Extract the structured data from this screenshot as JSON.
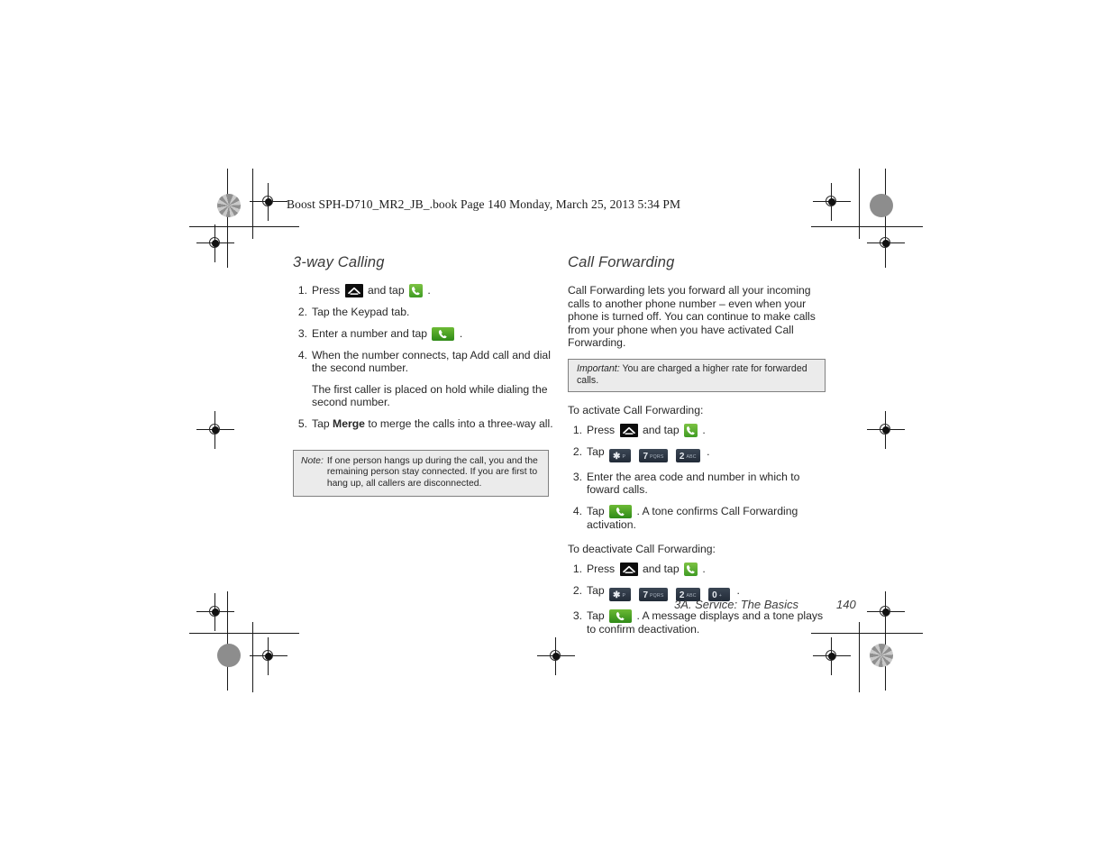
{
  "running_header": "Boost SPH-D710_MR2_JB_.book  Page 140  Monday, March 25, 2013  5:34 PM",
  "left_column": {
    "title": "3-way Calling",
    "steps": [
      {
        "num": "1.",
        "before": "Press",
        "icon1": "home-icon",
        "mid": "and tap",
        "icon2": "phone-green-icon",
        "after": "."
      },
      {
        "num": "2.",
        "text": "Tap the Keypad tab."
      },
      {
        "num": "3.",
        "before": "Enter a number and tap",
        "icon1": "phone-green-wide-icon",
        "after": "."
      },
      {
        "num": "4.",
        "text": "When the number connects, tap Add call and dial the second number."
      },
      {
        "num": "5.",
        "before": "Tap",
        "bold": "Merge",
        "after": "to merge the calls into a three-way all."
      }
    ],
    "sub_paragraph": "The first caller is placed on hold while dialing the second number.",
    "note": {
      "label": "Note:",
      "body": "If one person hangs up during the call, you and the remaining person stay connected. If you are first to hang up, all callers are disconnected."
    }
  },
  "right_column": {
    "title": "Call Forwarding",
    "intro": "Call Forwarding lets you forward all your incoming calls to another phone number – even when your phone is turned off. You can continue to make calls from your phone when you have activated Call Forwarding.",
    "important": {
      "label": "Important:",
      "body": "You are charged a higher rate for forwarded calls."
    },
    "activate_lead_in": "To activate Call Forwarding:",
    "activate_steps": [
      {
        "num": "1.",
        "before": "Press",
        "icon1": "home-icon",
        "mid": "and tap",
        "icon2": "phone-green-icon",
        "after": "."
      },
      {
        "num": "2.",
        "before": "Tap",
        "keys": [
          "star",
          "seven",
          "two"
        ],
        "after": "."
      },
      {
        "num": "3.",
        "text": "Enter the area code and number in which to foward calls."
      },
      {
        "num": "4.",
        "before": "Tap",
        "icon1": "phone-green-wide-icon",
        "after": ". A tone confirms Call Forwarding activation."
      }
    ],
    "deactivate_lead_in": "To deactivate Call Forwarding:",
    "deactivate_steps": [
      {
        "num": "1.",
        "before": "Press",
        "icon1": "home-icon",
        "mid": "and tap",
        "icon2": "phone-green-icon",
        "after": "."
      },
      {
        "num": "2.",
        "before": "Tap",
        "keys": [
          "star",
          "seven",
          "two",
          "zero"
        ],
        "after": "."
      },
      {
        "num": "3.",
        "before": "Tap",
        "icon1": "phone-green-wide-icon",
        "after": ". A message displays and a tone plays to confirm deactivation."
      }
    ]
  },
  "keys": {
    "star": {
      "main": "✱",
      "sub": "P"
    },
    "seven": {
      "main": "7",
      "sub": "PQRS"
    },
    "two": {
      "main": "2",
      "sub": "ABC"
    },
    "zero": {
      "main": "0",
      "sub": "+"
    }
  },
  "footer": {
    "chapter": "3A. Service: The Basics",
    "page_number": "140"
  },
  "colors": {
    "phone_green": "#5cb130",
    "home_black": "#0d0d0d",
    "key_navy": "#2e3846",
    "callout_bg": "#ebebeb",
    "callout_border": "#808080",
    "text": "#282828"
  }
}
